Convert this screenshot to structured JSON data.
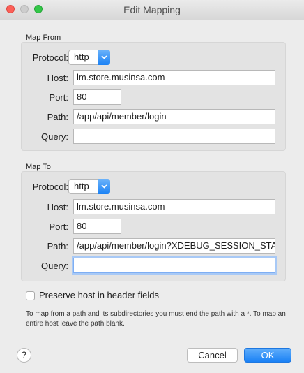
{
  "window": {
    "title": "Edit Mapping"
  },
  "map_from": {
    "label": "Map From",
    "protocol_label": "Protocol:",
    "protocol_value": "http",
    "host_label": "Host:",
    "host_value": "lm.store.musinsa.com",
    "port_label": "Port:",
    "port_value": "80",
    "path_label": "Path:",
    "path_value": "/app/api/member/login",
    "query_label": "Query:",
    "query_value": ""
  },
  "map_to": {
    "label": "Map To",
    "protocol_label": "Protocol:",
    "protocol_value": "http",
    "host_label": "Host:",
    "host_value": "lm.store.musinsa.com",
    "port_label": "Port:",
    "port_value": "80",
    "path_label": "Path:",
    "path_value": "/app/api/member/login?XDEBUG_SESSION_STA",
    "query_label": "Query:",
    "query_value": ""
  },
  "options": {
    "preserve_host_label": "Preserve host in header fields",
    "preserve_host_checked": false
  },
  "hint": "To map from a path and its subdirectories you must end the path with a *. To map an entire host leave the path blank.",
  "buttons": {
    "help": "?",
    "cancel": "Cancel",
    "ok": "OK"
  },
  "colors": {
    "accent": "#1a81f5",
    "close": "#fc5f57",
    "max": "#33c748",
    "focus_ring": "#a8c9f6"
  }
}
